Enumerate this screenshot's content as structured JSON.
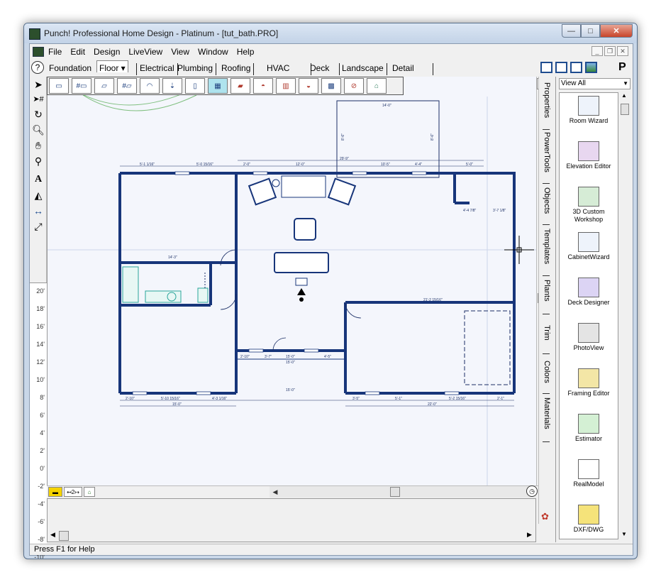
{
  "window": {
    "title": "Punch! Professional Home Design - Platinum - [tut_bath.PRO]"
  },
  "menu": {
    "items": [
      "File",
      "Edit",
      "Design",
      "LiveView",
      "View",
      "Window",
      "Help"
    ]
  },
  "tabs": {
    "items": [
      "Foundation",
      "Floor ▾",
      "Electrical",
      "Plumbing",
      "Roofing",
      "HVAC",
      "Deck",
      "Landscape",
      "Detail"
    ]
  },
  "view_filter": {
    "value": "View All"
  },
  "side_tabs": {
    "items": [
      "Properties",
      "PowerTools",
      "Objects",
      "Templates",
      "Plants",
      "Trim",
      "Colors",
      "Materials"
    ]
  },
  "tool_list": {
    "items": [
      {
        "label": "Room Wizard",
        "icon": "room-wizard-icon"
      },
      {
        "label": "Elevation Editor",
        "icon": "elevation-editor-icon"
      },
      {
        "label": "3D Custom Workshop",
        "icon": "custom-workshop-icon"
      },
      {
        "label": "CabinetWizard",
        "icon": "cabinet-wizard-icon"
      },
      {
        "label": "Deck Designer",
        "icon": "deck-designer-icon"
      },
      {
        "label": "PhotoView",
        "icon": "camera-icon"
      },
      {
        "label": "Framing Editor",
        "icon": "framing-editor-icon"
      },
      {
        "label": "Estimator",
        "icon": "calculator-icon"
      },
      {
        "label": "RealModel",
        "icon": "realmodel-icon"
      },
      {
        "label": "DXF/DWG",
        "icon": "dxf-dwg-icon"
      }
    ]
  },
  "ruler": {
    "labels": [
      "20'",
      "18'",
      "16'",
      "14'",
      "12'",
      "10'",
      "8'",
      "6'",
      "4'",
      "2'",
      "0'",
      "-2'",
      "-4'",
      "-6'",
      "-8'",
      "-10'"
    ]
  },
  "plan": {
    "dims": {
      "top_1": "5'-1 1/16\"",
      "top_2": "5'-0 15/16\"",
      "top_3": "29'-9\"",
      "top_4": "2'-0\"",
      "top_5": "12'-0\"",
      "top_6": "10'-5\"",
      "top_7": "4'-4\"",
      "top_8": "5'-0\"",
      "porch_top": "14'-0\"",
      "porch_side_left": "8'-6\"",
      "porch_side_right": "8'-6\"",
      "left_room": "14'-3\"",
      "closet_1": "4'-4 7/8\"",
      "closet_2": "3'-7 1/8\"",
      "mid_right": "21'-2 15/16\"",
      "hall_1": "2'-10\"",
      "hall_2": "3'-7\"",
      "hall_3": "15'-0\"",
      "hall_4": "4'-5\"",
      "hall_total": "15'-0\"",
      "bottom_left_1": "2'-10\"",
      "bottom_left_2": "5'-10 15/16\"",
      "bottom_left_3": "4'-3 1/16\"",
      "bottom_left_total": "15'-0\"",
      "bottom_mid": "15'-0\"",
      "bottom_right_1": "3'-5\"",
      "bottom_right_2": "5'-1\"",
      "bottom_right_3": "5'-2 15/16\"",
      "bottom_right_4": "2'-1\"",
      "bottom_right_total": "22'-0\""
    }
  },
  "status_bar": {
    "text": "Press F1 for Help"
  }
}
